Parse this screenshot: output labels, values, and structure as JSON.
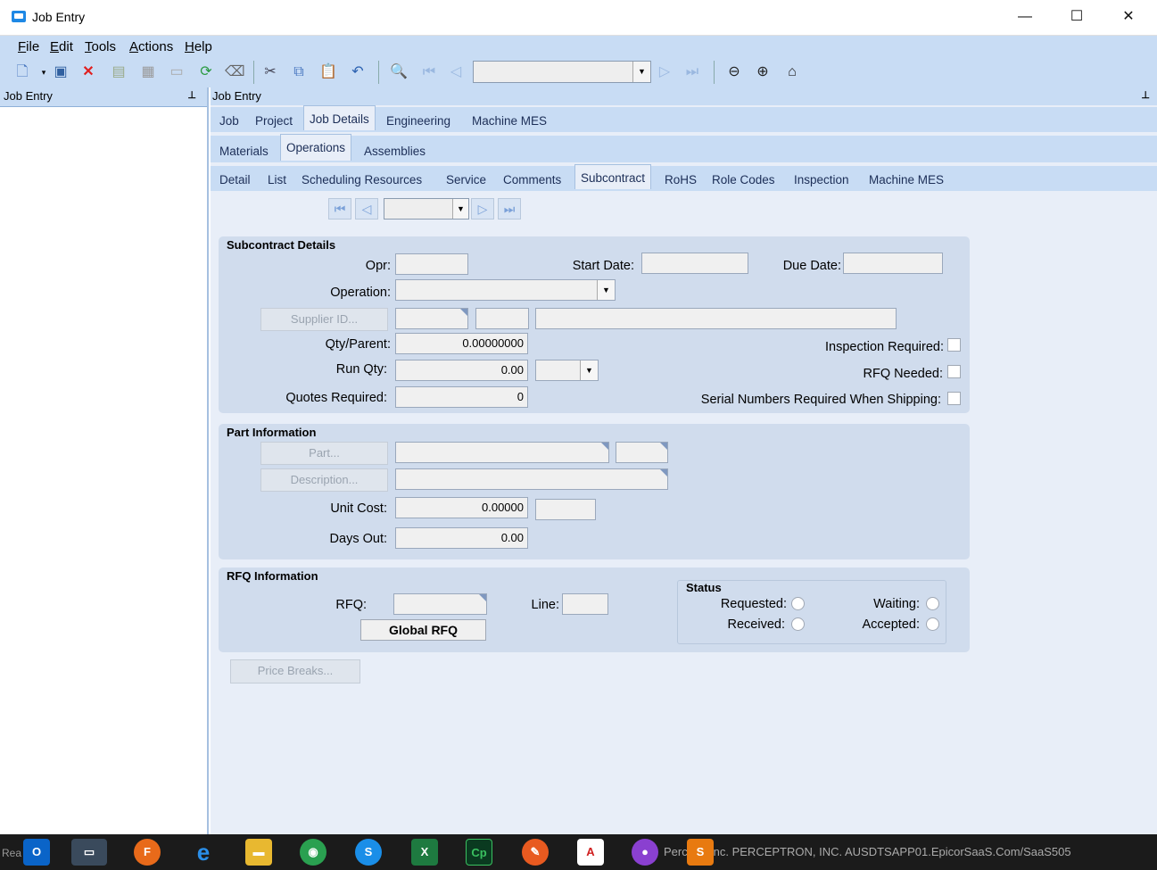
{
  "window": {
    "title": "Job Entry",
    "minimize": "—",
    "maximize": "☐",
    "close": "✕"
  },
  "menu": [
    "File",
    "Edit",
    "Tools",
    "Actions",
    "Help"
  ],
  "left_panel": {
    "title": "Job Entry",
    "pin": "ꟷ"
  },
  "main_panel": {
    "title": "Job Entry"
  },
  "tabs_l1": [
    "Job",
    "Project",
    "Job Details",
    "Engineering",
    "Machine MES"
  ],
  "tabs_l1_active": "Job Details",
  "tabs_l2": [
    "Materials",
    "Operations",
    "Assemblies"
  ],
  "tabs_l2_active": "Operations",
  "tabs_l3": [
    "Detail",
    "List",
    "Scheduling Resources",
    "Service",
    "Comments",
    "Subcontract",
    "RoHS",
    "Role Codes",
    "Inspection",
    "Machine MES"
  ],
  "tabs_l3_active": "Subcontract",
  "subcontract": {
    "title": "Subcontract Details",
    "opr_label": "Opr:",
    "start_date_label": "Start Date:",
    "due_date_label": "Due Date:",
    "operation_label": "Operation:",
    "supplier_button": "Supplier ID...",
    "qty_parent_label": "Qty/Parent:",
    "qty_parent_value": "0.00000000",
    "run_qty_label": "Run Qty:",
    "run_qty_value": "0.00",
    "quotes_required_label": "Quotes Required:",
    "quotes_required_value": "0",
    "inspection_required_label": "Inspection Required:",
    "rfq_needed_label": "RFQ Needed:",
    "serial_numbers_label": "Serial Numbers Required When Shipping:"
  },
  "part_info": {
    "title": "Part Information",
    "part_button": "Part...",
    "description_button": "Description...",
    "unit_cost_label": "Unit Cost:",
    "unit_cost_value": "0.00000",
    "days_out_label": "Days Out:",
    "days_out_value": "0.00"
  },
  "rfq_info": {
    "title": "RFQ Information",
    "rfq_label": "RFQ:",
    "line_label": "Line:",
    "global_rfq_button": "Global RFQ",
    "status_title": "Status",
    "requested_label": "Requested:",
    "received_label": "Received:",
    "waiting_label": "Waiting:",
    "accepted_label": "Accepted:"
  },
  "price_breaks_button": "Price Breaks...",
  "taskbar": {
    "status_left": "Rea",
    "status_text": "Perc       on, Inc.  PERCEPTRON, INC.   AUSDTSAPP01.EpicorSaaS.Com/SaaS505"
  }
}
